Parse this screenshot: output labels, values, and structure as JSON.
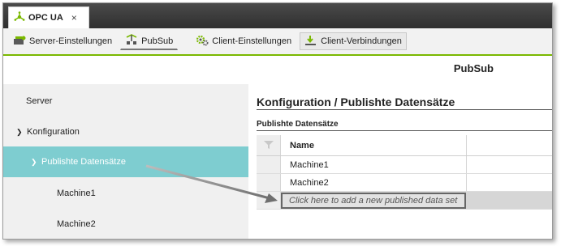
{
  "tab": {
    "title": "OPC UA",
    "close": "×"
  },
  "toolbar": {
    "items": [
      {
        "label": "Server-Einstellungen"
      },
      {
        "label": "PubSub"
      },
      {
        "label": "Client-Einstellungen"
      },
      {
        "label": "Client-Verbindungen"
      }
    ]
  },
  "page": {
    "title": "PubSub"
  },
  "nav": {
    "items": [
      {
        "label": "Server"
      },
      {
        "label": "Konfiguration"
      },
      {
        "label": "Publishte Datensätze"
      },
      {
        "label": "Machine1"
      },
      {
        "label": "Machine2"
      }
    ]
  },
  "content": {
    "title": "Konfiguration / Publishte Datensätze",
    "subtitle": "Publishte Datensätze",
    "table": {
      "header": "Name",
      "rows": [
        "Machine1",
        "Machine2"
      ],
      "add_placeholder": "Click here to add a new published data set"
    }
  },
  "colors": {
    "accent": "#7ab800",
    "active_nav": "#7ecdd0",
    "tabbar": "#3a3a3a"
  }
}
